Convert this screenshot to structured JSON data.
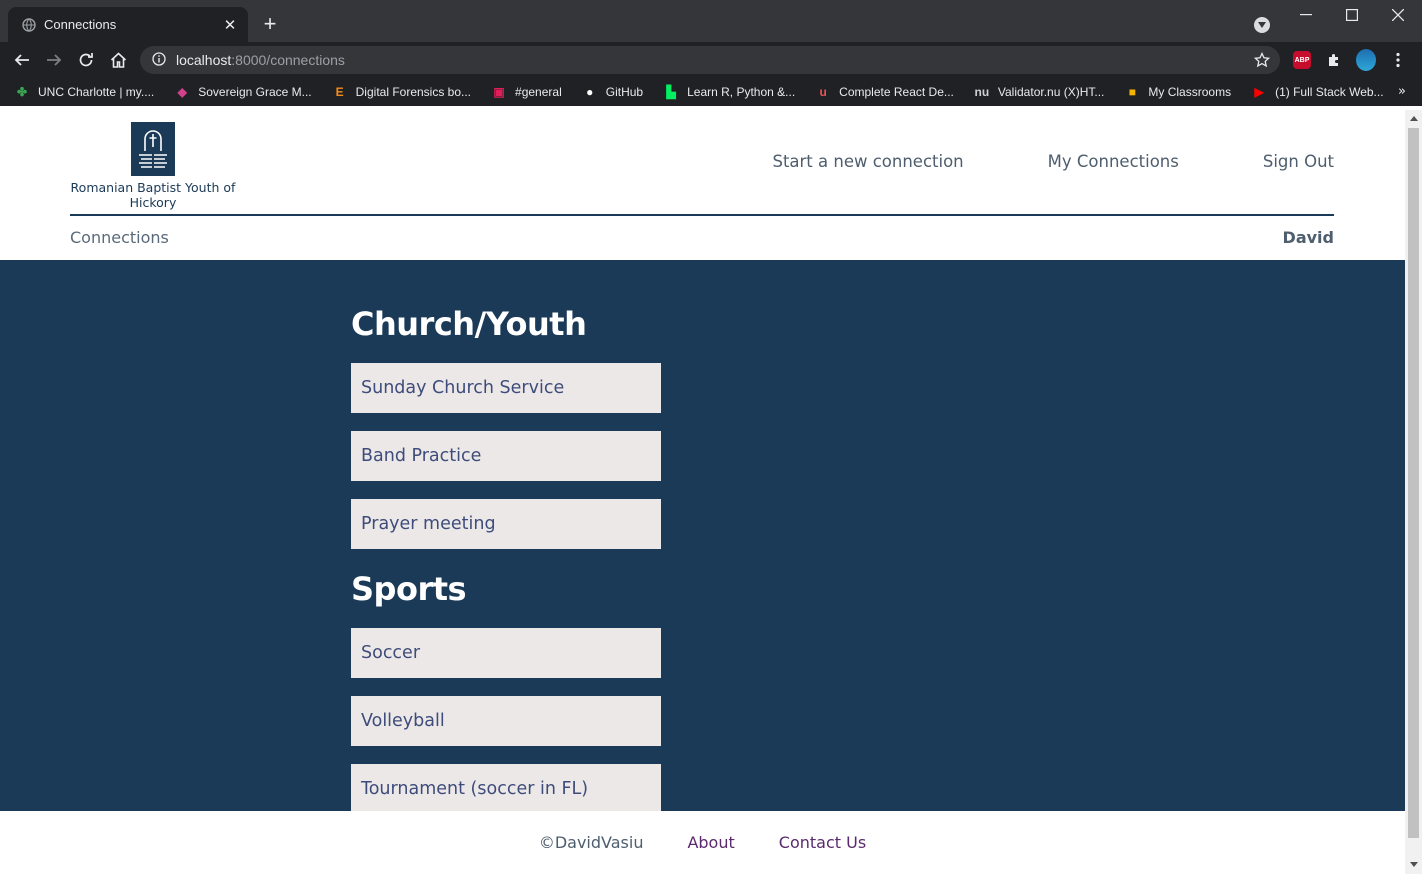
{
  "browser": {
    "tab_title": "Connections",
    "tab_close": "✕",
    "new_tab": "+",
    "url_host": "localhost",
    "url_path": ":8000/connections",
    "bookmarks": [
      {
        "label": "UNC Charlotte | my....",
        "icon": "unc-icon",
        "color": "#3aa655"
      },
      {
        "label": "Sovereign Grace M...",
        "icon": "sovereign-grace-icon",
        "color": "#d1428b"
      },
      {
        "label": "Digital Forensics bo...",
        "icon": "e-icon",
        "color": "#f58a1f"
      },
      {
        "label": "#general",
        "icon": "slack-icon",
        "color": "#e01e5a"
      },
      {
        "label": "GitHub",
        "icon": "github-icon",
        "color": "#ffffff"
      },
      {
        "label": "Learn R, Python &...",
        "icon": "datacamp-icon",
        "color": "#03ef62"
      },
      {
        "label": "Complete React De...",
        "icon": "udemy-icon",
        "color": "#ec5252"
      },
      {
        "label": "Validator.nu (X)HT...",
        "icon": "validator-icon",
        "color": "#cfcfcf"
      },
      {
        "label": "My Classrooms",
        "icon": "classroom-icon",
        "color": "#f5b400"
      },
      {
        "label": "(1) Full Stack Web...",
        "icon": "youtube-icon",
        "color": "#ff0000"
      }
    ],
    "more_bookmarks": "»"
  },
  "header": {
    "logo_text": "Romanian Baptist Youth of Hickory",
    "nav": [
      {
        "label": "Start a new connection"
      },
      {
        "label": "My Connections"
      },
      {
        "label": "Sign Out"
      }
    ]
  },
  "subbar": {
    "breadcrumb": "Connections",
    "user_name": "David"
  },
  "categories": [
    {
      "title": "Church/Youth",
      "items": [
        "Sunday Church Service",
        "Band Practice",
        "Prayer meeting"
      ]
    },
    {
      "title": "Sports",
      "items": [
        "Soccer",
        "Volleyball",
        "Tournament (soccer in FL)"
      ]
    }
  ],
  "footer": {
    "copyright": "©DavidVasiu",
    "about": "About",
    "contact": "Contact Us"
  },
  "colors": {
    "brand_navy": "#1b3a57",
    "card_bg": "#ede8e8",
    "card_text": "#3d4c7a"
  }
}
